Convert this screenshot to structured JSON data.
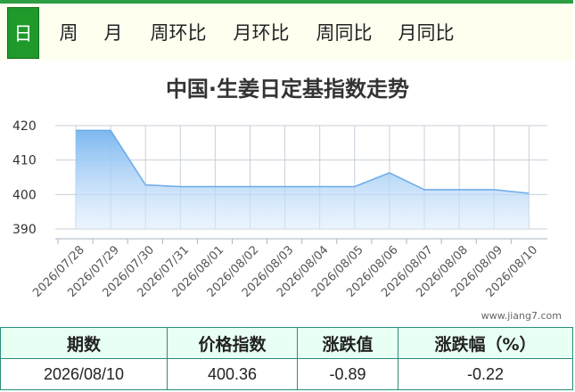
{
  "tabs": [
    "日",
    "周",
    "月",
    "周环比",
    "月环比",
    "周同比",
    "月同比"
  ],
  "active_tab": 0,
  "colors": {
    "accent": "#1f9a2a",
    "series_line": "#6aaae8",
    "area_top": "#7db8f0",
    "table_border": "#2d8c7a",
    "table_header_bg": "#e8fff3"
  },
  "chart_data": {
    "type": "area",
    "title": "中国·生姜日定基指数走势",
    "categories": [
      "2026/07/28",
      "2026/07/29",
      "2026/07/30",
      "2026/07/31",
      "2026/08/01",
      "2026/08/02",
      "2026/08/03",
      "2026/08/04",
      "2026/08/05",
      "2026/08/06",
      "2026/08/07",
      "2026/08/08",
      "2026/08/09",
      "2026/08/10"
    ],
    "series": [
      {
        "values": [
          418.6,
          418.6,
          402.8,
          402.3,
          402.3,
          402.3,
          402.3,
          402.3,
          402.3,
          406.3,
          401.4,
          401.4,
          401.4,
          400.36
        ]
      }
    ],
    "ylim": [
      390,
      420
    ],
    "yticks": [
      390,
      400,
      410,
      420
    ],
    "grid": true,
    "watermark": "www.jiang7.com"
  },
  "table": {
    "headers": [
      "期数",
      "价格指数",
      "涨跌值",
      "涨跌幅（%）"
    ],
    "rows": [
      [
        "2026/08/10",
        "400.36",
        "-0.89",
        "-0.22"
      ]
    ]
  }
}
